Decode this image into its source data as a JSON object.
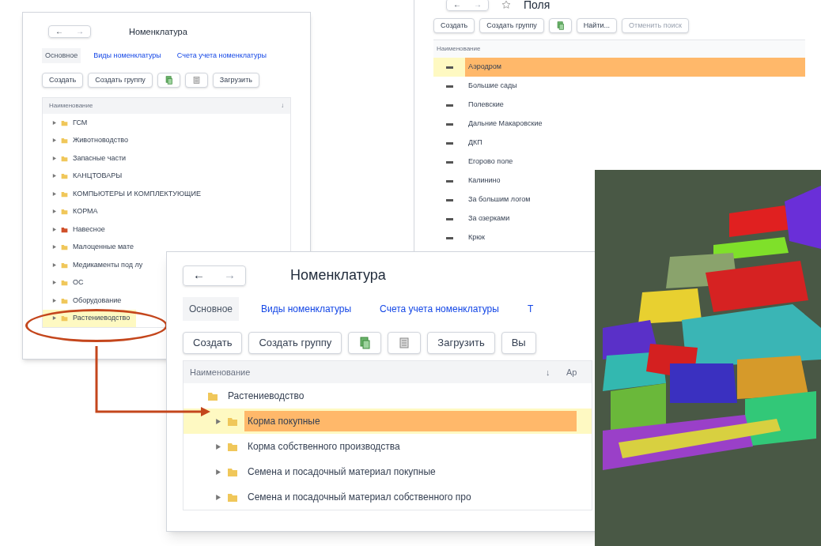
{
  "back_window": {
    "nav": [
      "←",
      "→"
    ],
    "title": "Номенклатура",
    "tabs": [
      {
        "label": "Основное",
        "selected": true
      },
      {
        "label": "Виды номенклатуры",
        "selected": false
      },
      {
        "label": "Счета учета номенклатуры",
        "selected": false
      }
    ],
    "buttons": [
      {
        "kind": "text",
        "label": "Создать"
      },
      {
        "kind": "text",
        "label": "Создать группу"
      },
      {
        "kind": "copy"
      },
      {
        "kind": "list"
      },
      {
        "kind": "text",
        "label": "Загрузить"
      }
    ],
    "column": "Наименование",
    "sort": "↓",
    "rows": [
      {
        "label": "ГСМ",
        "color": "#f0c75a",
        "selected": false
      },
      {
        "label": "Животноводство",
        "color": "#f0c75a",
        "selected": false
      },
      {
        "label": "Запасные части",
        "color": "#f0c75a",
        "selected": false
      },
      {
        "label": "КАНЦТОВАРЫ",
        "color": "#f0c75a",
        "selected": false
      },
      {
        "label": "КОМПЬЮТЕРЫ И КОМПЛЕКТУЮЩИЕ",
        "color": "#f0c75a",
        "selected": false
      },
      {
        "label": "КОРМА",
        "color": "#f0c75a",
        "selected": false
      },
      {
        "label": "Навесное",
        "color": "#d0502a",
        "selected": false
      },
      {
        "label": "Малоценные мате",
        "color": "#f0c75a",
        "selected": false
      },
      {
        "label": "Медикаменты под лу",
        "color": "#f0c75a",
        "selected": false
      },
      {
        "label": "ОС",
        "color": "#f0c75a",
        "selected": false
      },
      {
        "label": "Оборудование",
        "color": "#f0c75a",
        "selected": false
      },
      {
        "label": "Растениеводство",
        "color": "#f0c75a",
        "selected": true
      }
    ]
  },
  "fields_window": {
    "nav": [
      "←",
      "→"
    ],
    "title": "Поля",
    "buttons": [
      {
        "kind": "text",
        "label": "Создать",
        "disabled": false
      },
      {
        "kind": "text",
        "label": "Создать группу",
        "disabled": false
      },
      {
        "kind": "copy"
      },
      {
        "kind": "text",
        "label": "Найти...",
        "disabled": false
      },
      {
        "kind": "text",
        "label": "Отменить поиск",
        "disabled": true
      }
    ],
    "column": "Наименование",
    "rows": [
      {
        "label": "Аэродром",
        "selected": true
      },
      {
        "label": "Большие сады",
        "selected": false
      },
      {
        "label": "Полевские",
        "selected": false
      },
      {
        "label": "Дальние Макаровские",
        "selected": false
      },
      {
        "label": "ДКП",
        "selected": false
      },
      {
        "label": "Егорово поле",
        "selected": false
      },
      {
        "label": "Калинино",
        "selected": false
      },
      {
        "label": "За большим логом",
        "selected": false
      },
      {
        "label": "За озерками",
        "selected": false
      },
      {
        "label": "Крюк",
        "selected": false
      }
    ]
  },
  "main_window": {
    "nav": [
      "←",
      "→"
    ],
    "title": "Номенклатура",
    "tabs": [
      {
        "label": "Основное",
        "selected": true
      },
      {
        "label": "Виды номенклатуры",
        "selected": false
      },
      {
        "label": "Счета учета номенклатуры",
        "selected": false
      },
      {
        "label": "Т",
        "selected": false
      }
    ],
    "buttons": [
      {
        "kind": "text",
        "label": "Создать"
      },
      {
        "kind": "text",
        "label": "Создать группу"
      },
      {
        "kind": "copy"
      },
      {
        "kind": "list"
      },
      {
        "kind": "text",
        "label": "Загрузить"
      },
      {
        "kind": "text",
        "label": "Вы"
      }
    ],
    "columns": [
      "Наименование",
      "Ар"
    ],
    "sort": "↓",
    "tree": [
      {
        "label": "Растениеводство",
        "expanded": true,
        "selected": false,
        "children": [
          {
            "label": "Корма покупные",
            "selected": true
          },
          {
            "label": "Корма собственного производства",
            "selected": false
          },
          {
            "label": "Семена и посадочный материал покупные",
            "selected": false
          },
          {
            "label": "Семена и посадочный материал собственного про",
            "selected": false
          }
        ]
      }
    ]
  }
}
